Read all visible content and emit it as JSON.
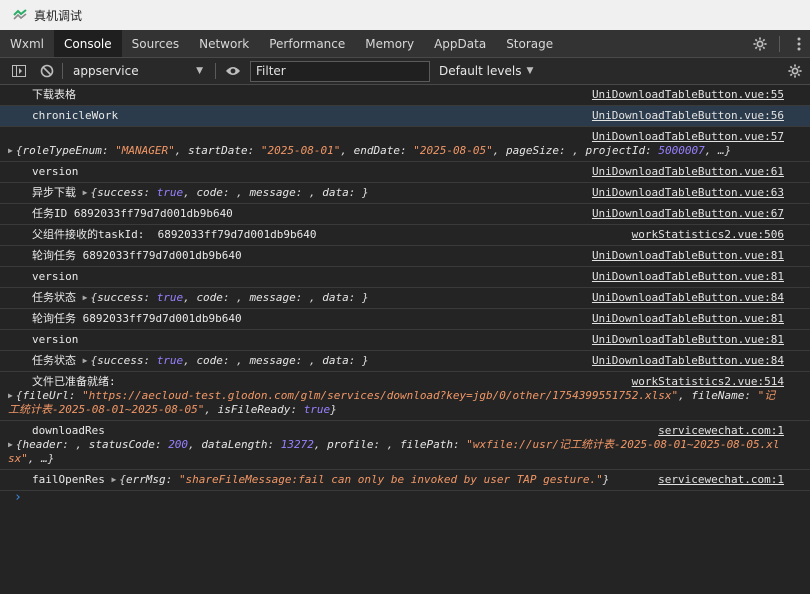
{
  "window": {
    "title": "真机调试"
  },
  "tabs": [
    {
      "label": "Wxml"
    },
    {
      "label": "Console"
    },
    {
      "label": "Sources"
    },
    {
      "label": "Network"
    },
    {
      "label": "Performance"
    },
    {
      "label": "Memory"
    },
    {
      "label": "AppData"
    },
    {
      "label": "Storage"
    }
  ],
  "active_tab": "Console",
  "toolbar": {
    "context": "appservice",
    "filter_placeholder": "Filter",
    "levels": "Default levels"
  },
  "colors": {
    "accent": "#3b8eea",
    "string": "#f29766",
    "number": "#9980ff",
    "selected_row": "#2c3b4b"
  },
  "console": {
    "rows": [
      {
        "msg": "下载表格",
        "src": "UniDownloadTableButton.vue:55"
      },
      {
        "msg": "chronicleWork",
        "src": "UniDownloadTableButton.vue:56"
      },
      {
        "src": "UniDownloadTableButton.vue:57",
        "obj": {
          "roleTypeEnum_key": "roleTypeEnum",
          "roleTypeEnum_val": "\"MANAGER\"",
          "startDate_key": "startDate",
          "startDate_val": "\"2025-08-01\"",
          "endDate_key": "endDate",
          "endDate_val": "\"2025-08-05\"",
          "pageSize_key": "pageSize",
          "projectId_key": "projectId",
          "projectId_val": "5000007",
          "ellipsis": "…"
        }
      },
      {
        "msg": "version",
        "src": "UniDownloadTableButton.vue:61"
      },
      {
        "msg": "异步下载",
        "src": "UniDownloadTableButton.vue:63"
      },
      {
        "msg": "任务ID 6892033ff79d7d001db9b640",
        "src": "UniDownloadTableButton.vue:67"
      },
      {
        "msg": "父组件接收的taskId:  6892033ff79d7d001db9b640",
        "src": "workStatistics2.vue:506"
      },
      {
        "msg": "轮询任务 6892033ff79d7d001db9b640",
        "src": "UniDownloadTableButton.vue:81"
      },
      {
        "msg": "version",
        "src": "UniDownloadTableButton.vue:81"
      },
      {
        "msg": "任务状态",
        "src": "UniDownloadTableButton.vue:84"
      },
      {
        "msg": "轮询任务 6892033ff79d7d001db9b640",
        "src": "UniDownloadTableButton.vue:81"
      },
      {
        "msg": "version",
        "src": "UniDownloadTableButton.vue:81"
      },
      {
        "msg": "任务状态",
        "src": "UniDownloadTableButton.vue:84"
      },
      {
        "msg": "文件已准备就绪:",
        "src": "workStatistics2.vue:514",
        "fileUrl_key": "fileUrl",
        "fileUrl_val": "\"https://aecloud-test.glodon.com/glm/services/download?key=jgb/0/other/1754399551752.xlsx\"",
        "fileName_key": "fileName",
        "fileName_val": "\"记工统计表-2025-08-01~2025-08-05\"",
        "isFileReady_key": "isFileReady",
        "isFileReady_val": "true"
      },
      {
        "msg": "downloadRes",
        "src": "servicewechat.com:1",
        "header_key": "header",
        "statusCode_key": "statusCode",
        "statusCode_val": "200",
        "dataLength_key": "dataLength",
        "dataLength_val": "13272",
        "profile_key": "profile",
        "filePath_key": "filePath",
        "filePath_val": "\"wxfile://usr/记工统计表-2025-08-01~2025-08-05.xlsx\"",
        "ellipsis": "…"
      },
      {
        "msg": "failOpenRes",
        "src": "servicewechat.com:1",
        "errMsg_key": "errMsg",
        "errMsg_val": "\"shareFileMessage:fail can only be invoked by user TAP gesture.\""
      }
    ],
    "status_obj": {
      "success_key": "success",
      "success_val": "true",
      "code_key": "code",
      "message_key": "message",
      "data_key": "data"
    },
    "prompt": "›"
  }
}
